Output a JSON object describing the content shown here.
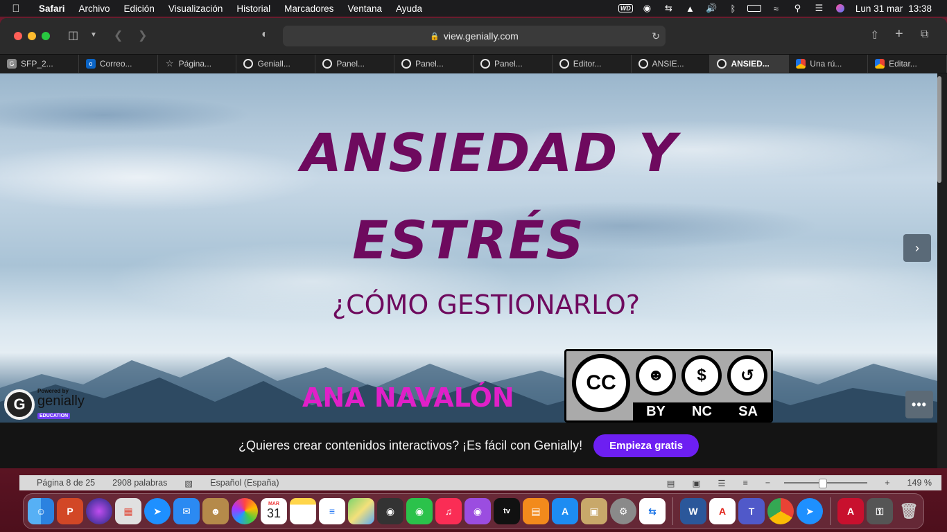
{
  "menubar": {
    "app_name": "Safari",
    "items": [
      "Archivo",
      "Edición",
      "Visualización",
      "Historial",
      "Marcadores",
      "Ventana",
      "Ayuda"
    ],
    "date": "Lun 31 mar",
    "time": "13:38"
  },
  "browser": {
    "url": "view.genially.com",
    "tabs": [
      {
        "label": "SFP_2...",
        "icon": "gray"
      },
      {
        "label": "Correo...",
        "icon": "outlook"
      },
      {
        "label": "Página...",
        "icon": "star"
      },
      {
        "label": "Geniall...",
        "icon": "g"
      },
      {
        "label": "Panel...",
        "icon": "g"
      },
      {
        "label": "Panel...",
        "icon": "g"
      },
      {
        "label": "Panel...",
        "icon": "g"
      },
      {
        "label": "Editor...",
        "icon": "g"
      },
      {
        "label": "ANSIE...",
        "icon": "g"
      },
      {
        "label": "ANSIED...",
        "icon": "g",
        "active": true
      },
      {
        "label": "Una rú...",
        "icon": "multi"
      },
      {
        "label": "Editar...",
        "icon": "multi"
      }
    ]
  },
  "slide": {
    "title_line1": "ANSIEDAD Y",
    "title_line2": "ESTRÉS",
    "subtitle": "¿CÓMO GESTIONARLO?",
    "author": "ANA NAVALÓN",
    "title_color": "#6e0a5e",
    "author_color": "#e020c8",
    "license": {
      "labels": [
        "BY",
        "NC",
        "SA"
      ],
      "cc_text": "CC"
    },
    "genially_badge": {
      "powered": "Powered by",
      "name": "genially",
      "edu": "EDUCATION"
    }
  },
  "banner": {
    "text": "¿Quieres crear contenidos interactivos? ¡Es fácil con Genially!",
    "cta": "Empieza gratis",
    "cta_color": "#6d1ff2"
  },
  "word_status": {
    "page": "Página 8 de 25",
    "words": "2908 palabras",
    "language": "Español (España)",
    "zoom": "149 %"
  },
  "dock": {
    "calendar_month": "MAR",
    "calendar_day": "31"
  }
}
